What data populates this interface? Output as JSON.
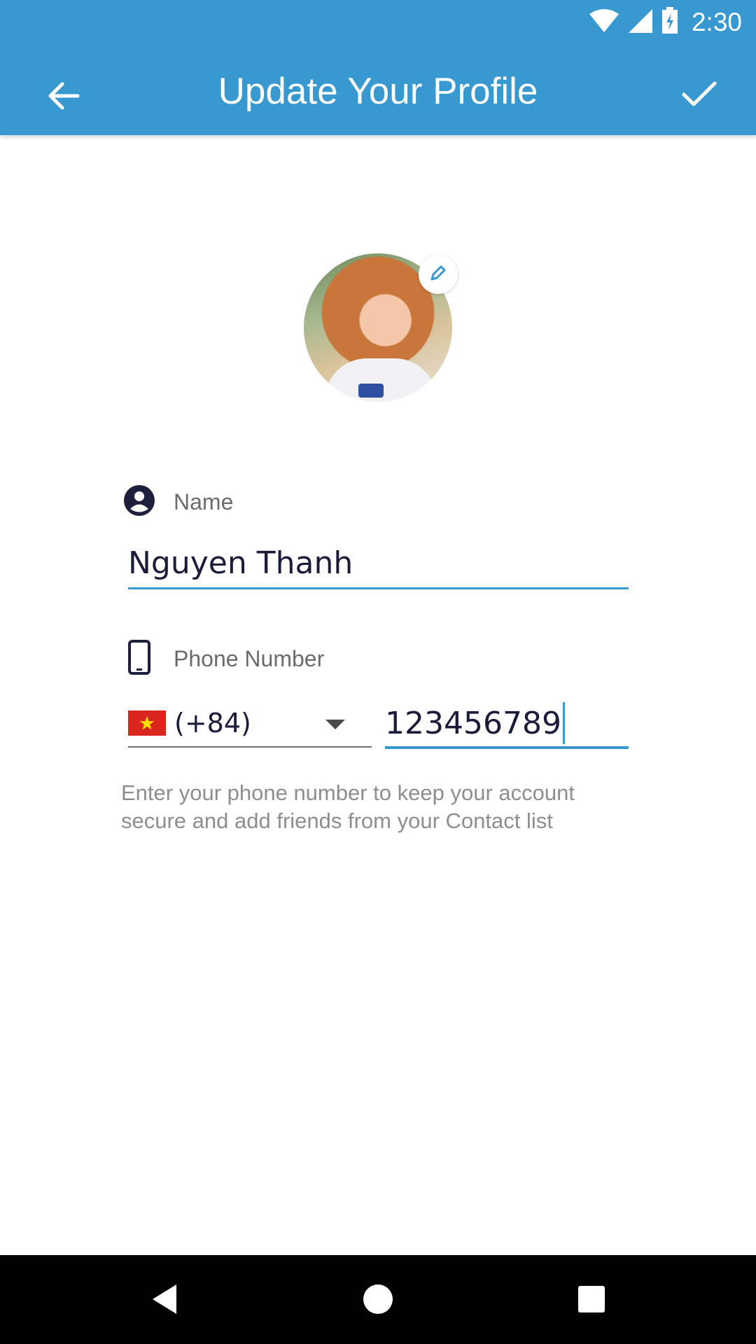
{
  "status_bar": {
    "time": "2:30",
    "icons": [
      "wifi-icon",
      "cell-signal-icon",
      "battery-charging-icon"
    ]
  },
  "app_bar": {
    "title": "Update Your Profile",
    "back_icon": "arrow-left-icon",
    "confirm_icon": "checkmark-icon",
    "background_color": "#3799cf"
  },
  "profile": {
    "edit_icon": "pencil-icon"
  },
  "form": {
    "name": {
      "icon": "account-circle-icon",
      "label": "Name",
      "value": "Nguyen Thanh"
    },
    "phone": {
      "icon": "smartphone-icon",
      "label": "Phone Number",
      "country_flag": "vietnam-flag-icon",
      "country_code": "(+84)",
      "value": "123456789"
    },
    "hint": "Enter your phone number to keep your account secure and add friends from your Contact list"
  },
  "nav_bar": {
    "icons": [
      "nav-back-icon",
      "nav-home-icon",
      "nav-recents-icon"
    ]
  }
}
